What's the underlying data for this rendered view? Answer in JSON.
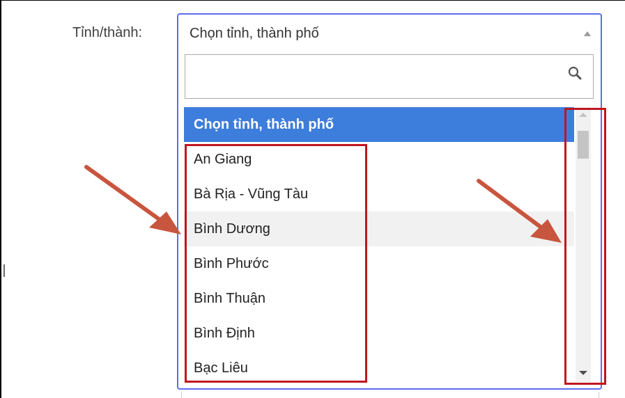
{
  "form": {
    "label": "Tỉnh/thành:"
  },
  "dropdown": {
    "selected_value": "Chọn tỉnh, thành phố",
    "search_placeholder": "",
    "options": [
      {
        "label": "Chọn tỉnh, thành phố",
        "state": "highlighted"
      },
      {
        "label": "An Giang",
        "state": "normal"
      },
      {
        "label": "Bà Rịa - Vũng Tàu",
        "state": "normal"
      },
      {
        "label": "Bình Dương",
        "state": "hover"
      },
      {
        "label": "Bình Phước",
        "state": "normal"
      },
      {
        "label": "Bình Thuận",
        "state": "normal"
      },
      {
        "label": "Bình Định",
        "state": "normal"
      },
      {
        "label": "Bạc Liêu",
        "state": "normal"
      }
    ]
  },
  "icons": {
    "search": "search-icon",
    "caret_up": "chevron-up-icon",
    "scroll_up": "scroll-up-arrow-icon",
    "scroll_down": "scroll-down-arrow-icon"
  },
  "colors": {
    "focus_border": "#5e6cf0",
    "highlight_bg": "#3d7ddb",
    "annotation": "#c0161f",
    "arrow": "#c8553d"
  }
}
